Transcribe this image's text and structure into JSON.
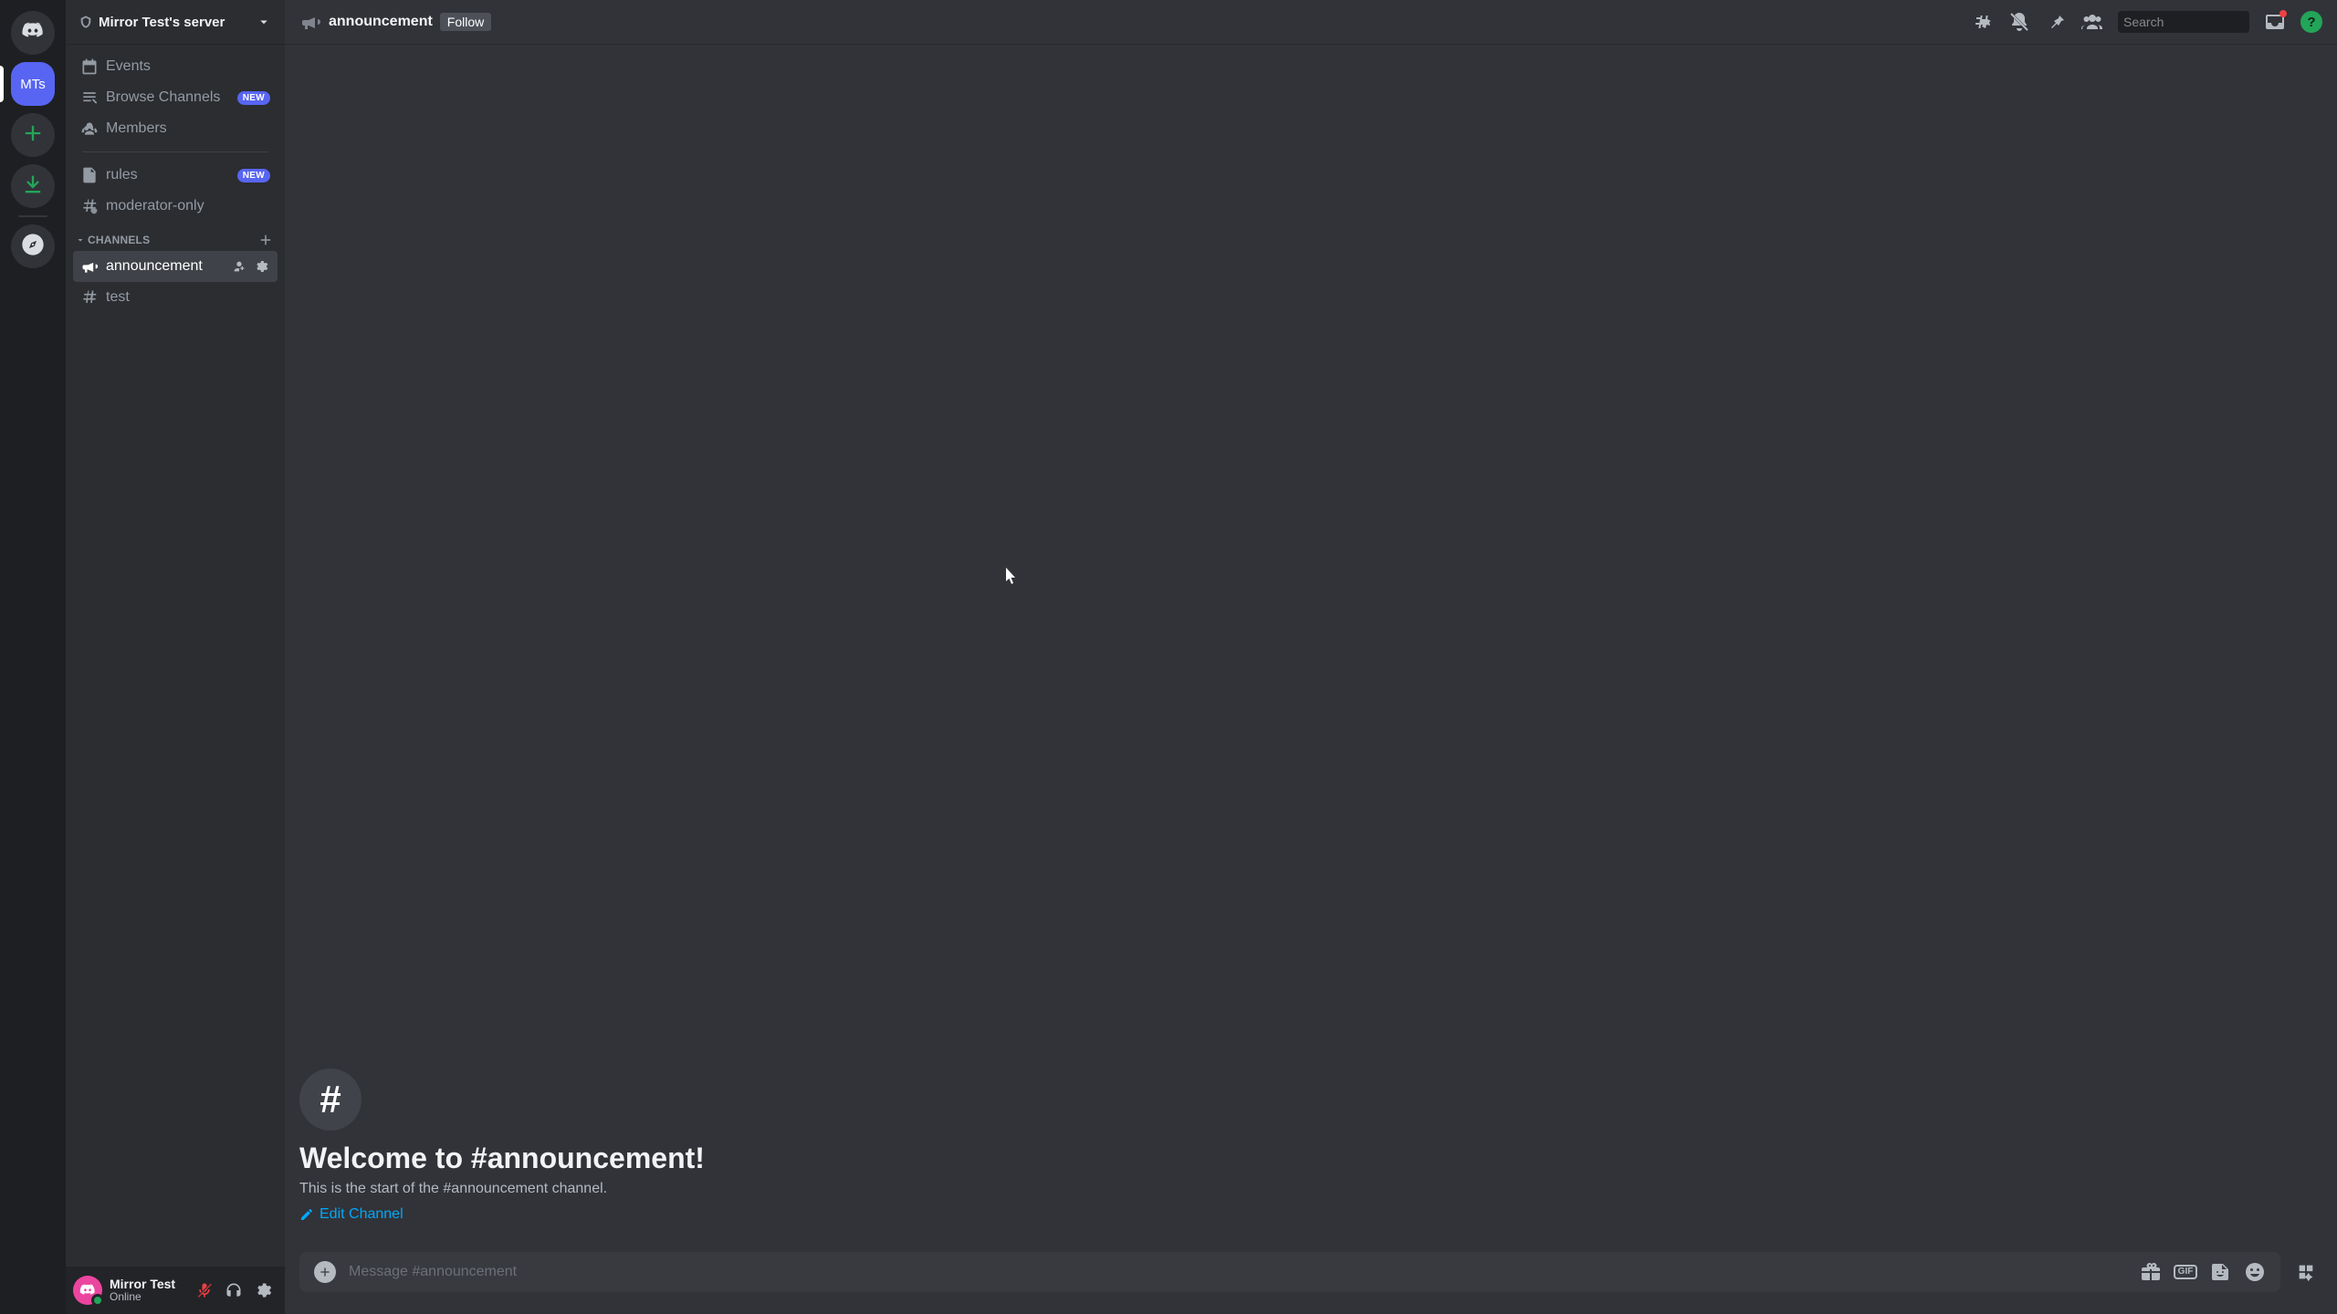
{
  "server": {
    "name": "Mirror Test's server",
    "initials": "MTs"
  },
  "sidebar": {
    "events": "Events",
    "browse": "Browse Channels",
    "members": "Members",
    "rules": "rules",
    "moderator": "moderator-only",
    "new_badge": "NEW",
    "category": "CHANNELS",
    "channels": [
      {
        "name": "announcement",
        "type": "announcement",
        "active": true
      },
      {
        "name": "test",
        "type": "text",
        "active": false
      }
    ]
  },
  "user": {
    "name": "Mirror Test",
    "status": "Online"
  },
  "header": {
    "channel": "announcement",
    "follow": "Follow",
    "search_placeholder": "Search"
  },
  "welcome": {
    "title": "Welcome to #announcement!",
    "subtitle": "This is the start of the #announcement channel.",
    "edit": "Edit Channel"
  },
  "composer": {
    "placeholder": "Message #announcement"
  },
  "help_glyph": "?"
}
